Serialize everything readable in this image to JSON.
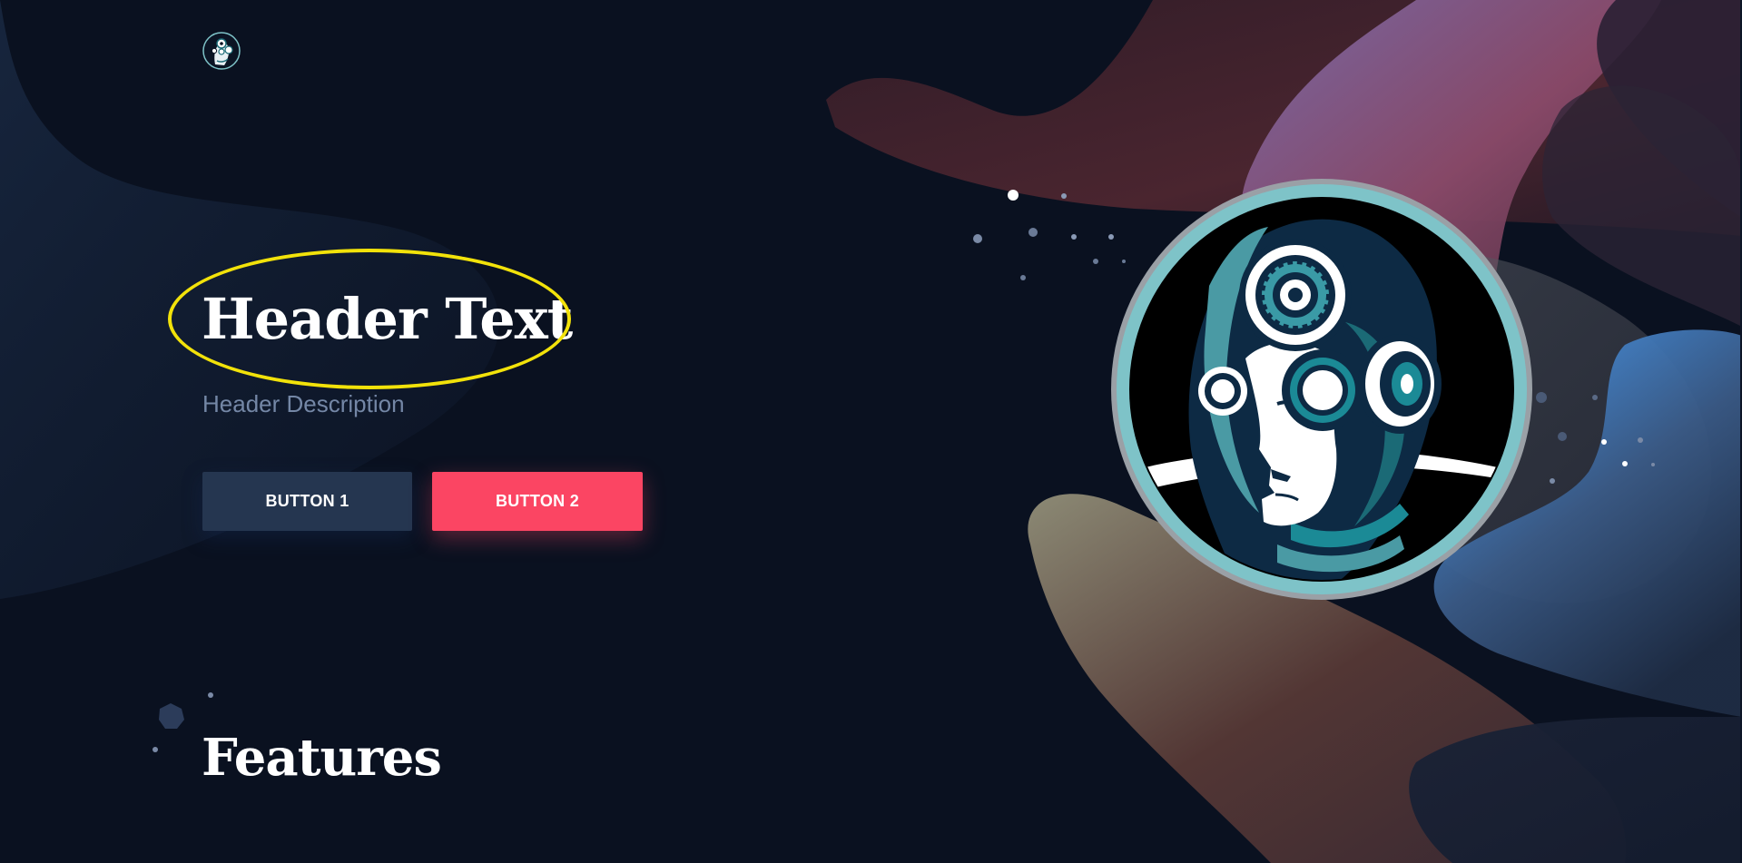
{
  "hero": {
    "header_text": "Header Text",
    "header_description": "Header Description",
    "button_1_label": "BUTTON 1",
    "button_2_label": "BUTTON 2"
  },
  "features": {
    "title": "Features"
  },
  "icons": {
    "logo": "robot-head-logo-icon",
    "hero_image": "robot-head-illustration"
  },
  "colors": {
    "background": "#0a1120",
    "button_1": "#253650",
    "button_2": "#fb4563",
    "description_text": "#7487a6",
    "highlight_ring": "#f2e20a",
    "accent_teal": "#7ec3c8"
  }
}
